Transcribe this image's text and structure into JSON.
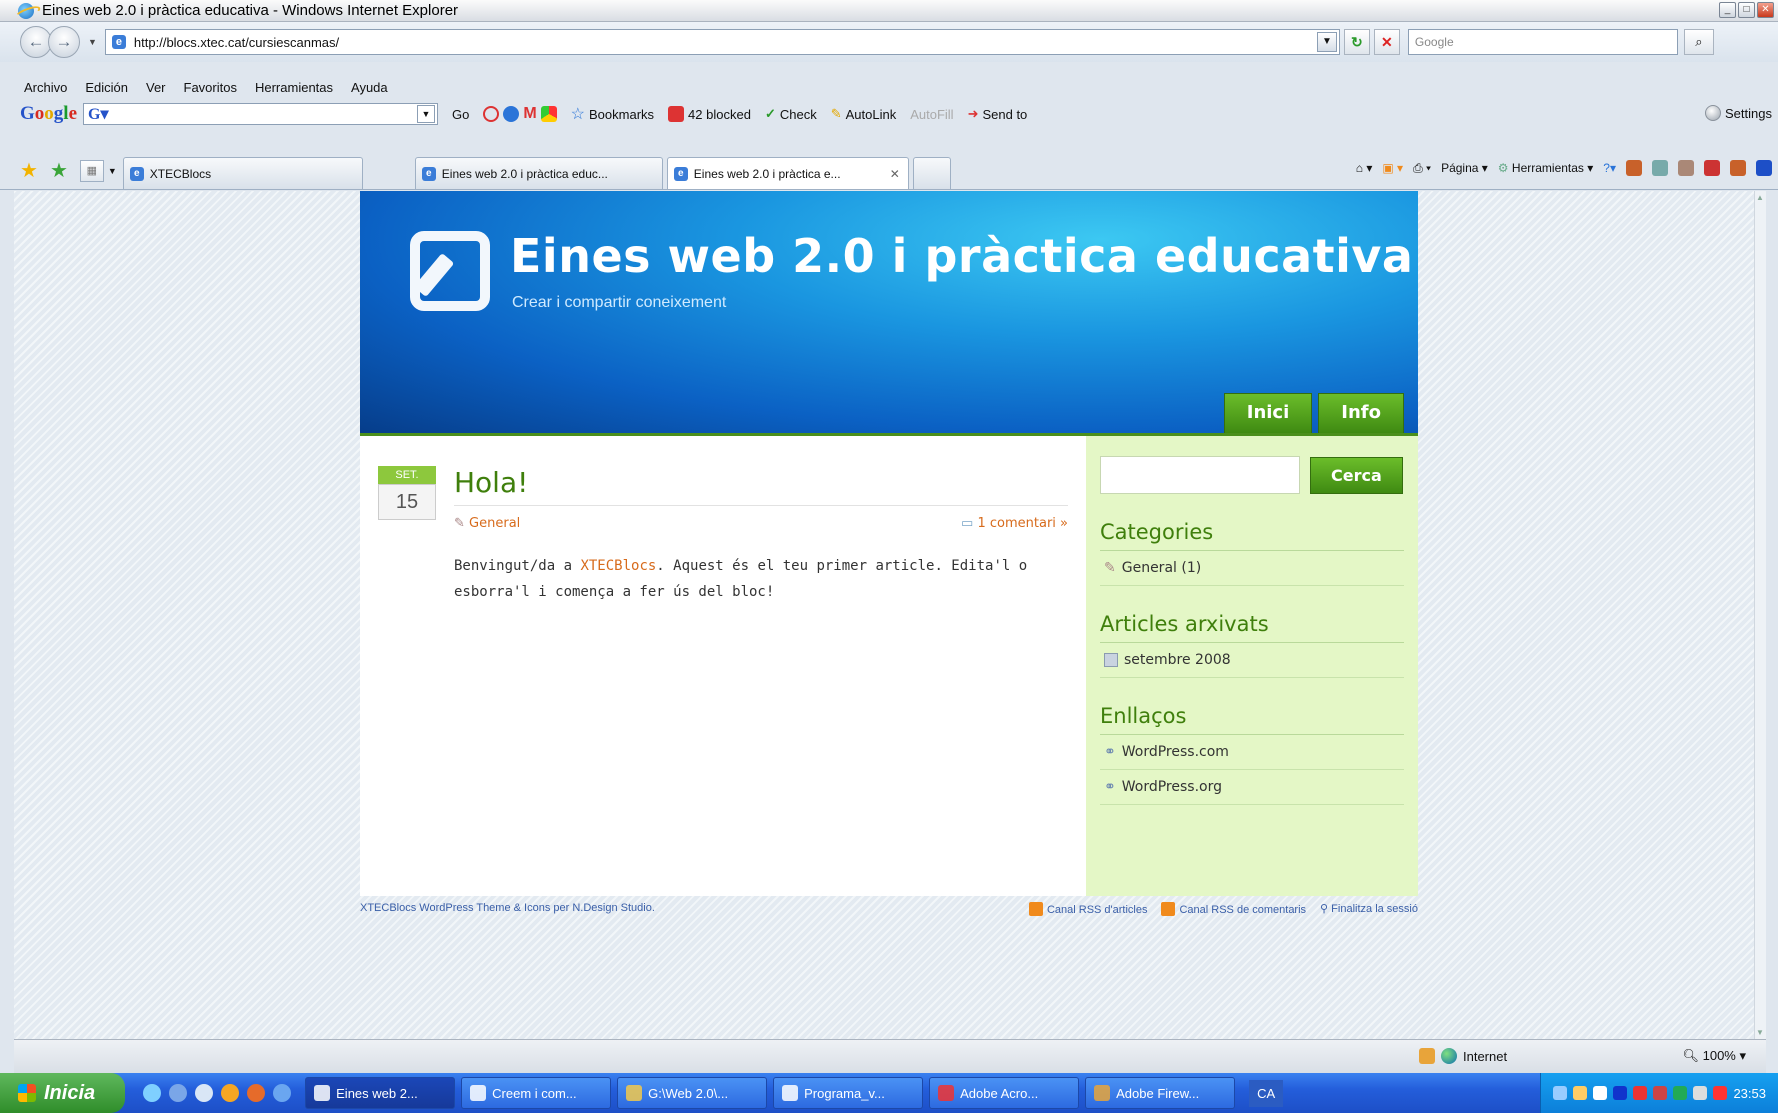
{
  "window": {
    "title": "Eines web 2.0 i pràctica educativa - Windows Internet Explorer"
  },
  "address_bar": {
    "url": "http://blocs.xtec.cat/cursiescanmas/",
    "search_placeholder": "Google"
  },
  "menu": [
    "Archivo",
    "Edición",
    "Ver",
    "Favoritos",
    "Herramientas",
    "Ayuda"
  ],
  "google_toolbar": {
    "go_label": "Go",
    "bookmarks_label": "Bookmarks",
    "blocked_label": "42 blocked",
    "check_label": "Check",
    "autolink_label": "AutoLink",
    "autofill_label": "AutoFill",
    "sendto_label": "Send to",
    "settings_label": "Settings"
  },
  "tabs": [
    {
      "label": "XTECBlocs",
      "active": false
    },
    {
      "label": "Eines web 2.0 i pràctica educ...",
      "active": false
    },
    {
      "label": "Eines web 2.0 i pràctica e...",
      "active": true
    }
  ],
  "command_bar": {
    "page_label": "Página",
    "tools_label": "Herramientas"
  },
  "site": {
    "title": "Eines web 2.0 i pràctica educativa",
    "subtitle": "Crear i compartir coneixement",
    "nav": [
      "Inici",
      "Info"
    ],
    "post": {
      "month": "SET.",
      "day": "15",
      "title": "Hola!",
      "category": "General",
      "comments": "1 comentari »",
      "body_before": "Benvingut/da a ",
      "body_link": "XTECBlocs",
      "body_after": ". Aquest és el teu primer article. Edita'l o esborra'l i comença a fer ús del bloc!"
    },
    "sidebar": {
      "search_button": "Cerca",
      "categories_title": "Categories",
      "categories": [
        "General (1)"
      ],
      "archives_title": "Articles arxivats",
      "archives": [
        "setembre 2008"
      ],
      "links_title": "Enllaços",
      "links": [
        "WordPress.com",
        "WordPress.org"
      ]
    },
    "footer": {
      "credit_a": "XTECBlocs WordPress Theme",
      "credit_b": " & ",
      "credit_c": "Icons",
      "credit_d": " per ",
      "credit_e": "N.Design Studio.",
      "rss_articles": "Canal RSS d'articles",
      "rss_comments": "Canal RSS de comentaris",
      "logout": "Finalitza la sessió"
    }
  },
  "status_bar": {
    "zone": "Internet",
    "zoom": "100%"
  },
  "taskbar": {
    "start": "Inicia",
    "tasks": [
      {
        "label": "Eines web 2...",
        "active": true
      },
      {
        "label": "Creem i com...",
        "active": false
      },
      {
        "label": "G:\\Web 2.0\\...",
        "active": false
      },
      {
        "label": "Programa_v...",
        "active": false
      },
      {
        "label": "Adobe Acro...",
        "active": false
      },
      {
        "label": "Adobe Firew...",
        "active": false
      }
    ],
    "lang": "CA",
    "clock": "23:53"
  }
}
